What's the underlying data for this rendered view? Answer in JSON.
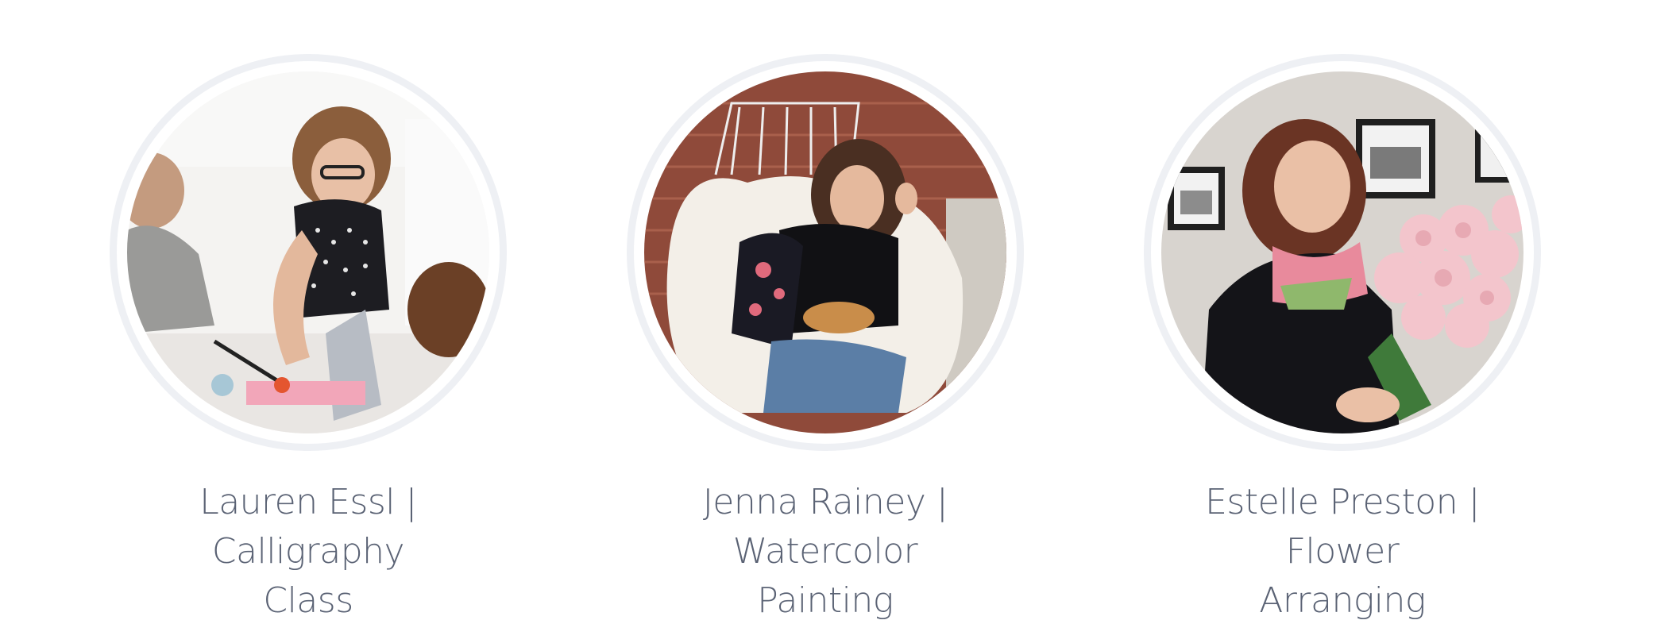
{
  "instructors": [
    {
      "caption_line1": "Lauren Essl | Calligraphy",
      "caption_line2": "Class",
      "photo_subject": "calligraphy-class-photo"
    },
    {
      "caption_line1": "Jenna Rainey | Watercolor",
      "caption_line2": "Painting",
      "photo_subject": "watercolor-painting-photo"
    },
    {
      "caption_line1": "Estelle Preston | Flower",
      "caption_line2": "Arranging",
      "photo_subject": "flower-arranging-photo"
    }
  ],
  "colors": {
    "caption_text": "#5a6274",
    "ring_border": "#eef0f4",
    "background": "#ffffff"
  }
}
